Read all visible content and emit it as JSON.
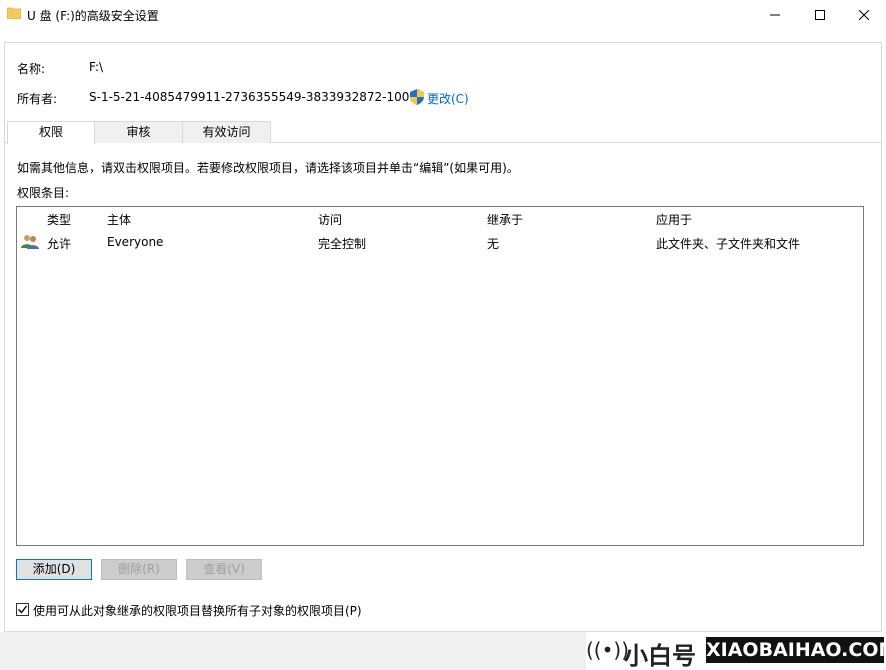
{
  "window": {
    "title": "U 盘 (F:)的高级安全设置",
    "icons": {
      "app": "folder-icon",
      "minimize": "minimize-icon",
      "maximize": "maximize-icon",
      "close": "close-icon"
    }
  },
  "header": {
    "name_label": "名称:",
    "name_value": "F:\\",
    "owner_label": "所有者:",
    "owner_value": "S-1-5-21-4085479911-2736355549-3833932872-1001",
    "change_link": "更改(C)"
  },
  "tabs": [
    {
      "label": "权限",
      "active": true
    },
    {
      "label": "审核",
      "active": false
    },
    {
      "label": "有效访问",
      "active": false
    }
  ],
  "info_text": "如需其他信息，请双击权限项目。若要修改权限项目，请选择该项目并单击“编辑”(如果可用)。",
  "entries_label": "权限条目:",
  "table": {
    "columns": [
      "类型",
      "主体",
      "访问",
      "继承于",
      "应用于"
    ],
    "rows": [
      {
        "type": "允许",
        "principal": "Everyone",
        "access": "完全控制",
        "inherited": "无",
        "applies_to": "此文件夹、子文件夹和文件"
      }
    ]
  },
  "buttons": {
    "add": "添加(D)",
    "remove": "删除(R)",
    "view": "查看(V)"
  },
  "checkbox": {
    "label": "使用可从此对象继承的权限项目替换所有子对象的权限项目(P)",
    "checked": true
  },
  "watermark": {
    "cn": "小白号",
    "en": "XIAOBAIHAO.COM"
  },
  "colors": {
    "link": "#0066cc",
    "focus_border": "#0078d7"
  }
}
